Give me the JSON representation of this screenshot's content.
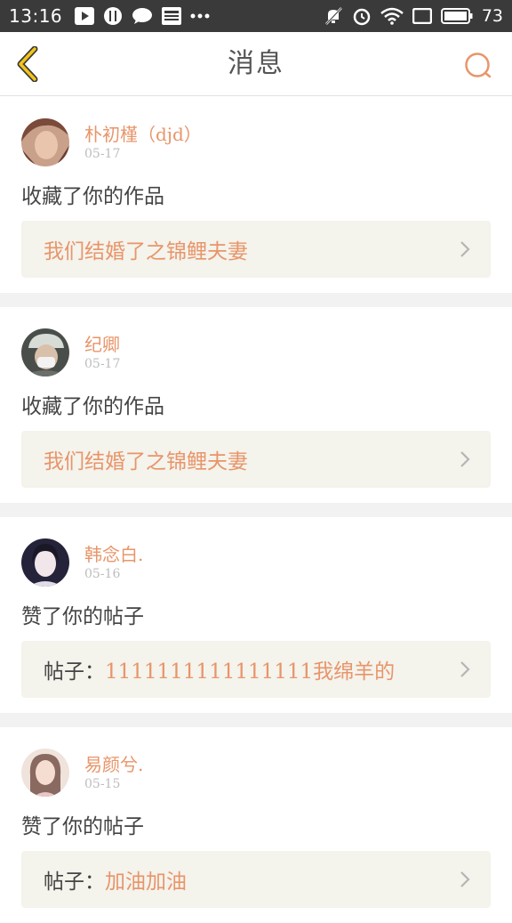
{
  "status_bar": {
    "time": "13:16",
    "battery": "73",
    "left_icons": [
      "play-icon",
      "cutlery-icon",
      "chat-bubble-icon",
      "news-icon",
      "more-dots-icon"
    ],
    "right_icons": [
      "mute-icon",
      "alarm-icon",
      "wifi-icon",
      "screen-icon",
      "battery-icon"
    ]
  },
  "header": {
    "title": "消息",
    "back_icon": "chevron-left-icon",
    "search_icon": "search-icon"
  },
  "colors": {
    "accent": "#e8956a",
    "back_yellow": "#f3c318",
    "link_box_bg": "#f4f3ec",
    "divider_bg": "#f2f2f2",
    "status_bar_bg": "#3a3a3a"
  },
  "messages": [
    {
      "username": "朴初槿（djd）",
      "date": "05-17",
      "action": "收藏了你的作品",
      "link_prefix": "",
      "link_text": "我们结婚了之锦鲤夫妻",
      "avatar_colors": [
        "#c9a08a",
        "#7a4a3a"
      ]
    },
    {
      "username": "纪卿",
      "date": "05-17",
      "action": "收藏了你的作品",
      "link_prefix": "",
      "link_text": "我们结婚了之锦鲤夫妻",
      "avatar_colors": [
        "#cfd4cf",
        "#4a4e4a"
      ]
    },
    {
      "username": "韩念白.",
      "date": "05-16",
      "action": "赞了你的帖子",
      "link_prefix": "帖子：",
      "link_text": "1111111111111111我绵羊的",
      "avatar_colors": [
        "#e8e2ea",
        "#24233a"
      ]
    },
    {
      "username": "易颜兮.",
      "date": "05-15",
      "action": "赞了你的帖子",
      "link_prefix": "帖子：",
      "link_text": "加油加油",
      "avatar_colors": [
        "#efe3dc",
        "#8a6a60"
      ]
    }
  ]
}
